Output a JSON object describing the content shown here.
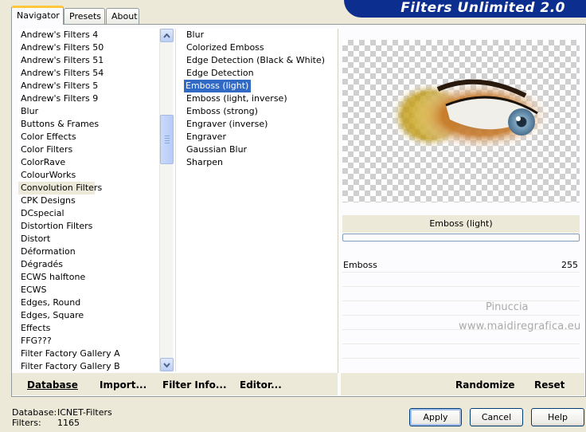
{
  "tabs": [
    "Navigator",
    "Presets",
    "About"
  ],
  "banner": "Filters Unlimited 2.0",
  "categories": [
    "Andrew's Filters 4",
    "Andrew's Filters 50",
    "Andrew's Filters 51",
    "Andrew's Filters 54",
    "Andrew's Filters 5",
    "Andrew's Filters 9",
    "Blur",
    "Buttons & Frames",
    "Color Effects",
    "Color Filters",
    "ColorRave",
    "ColourWorks",
    "Convolution Filters",
    "CPK Designs",
    "DCspecial",
    "Distortion Filters",
    "Distort",
    "Déformation",
    "Dégradés",
    "ECWS halftone",
    "ECWS",
    "Edges, Round",
    "Edges, Square",
    "Effects",
    "FFG???",
    "Filter Factory Gallery A",
    "Filter Factory Gallery B"
  ],
  "filters": [
    "Blur",
    "Colorized Emboss",
    "Edge Detection (Black & White)",
    "Edge Detection",
    "Emboss (light)",
    "Emboss (light, inverse)",
    "Emboss (strong)",
    "Engraver (inverse)",
    "Engraver",
    "Gaussian Blur",
    "Sharpen"
  ],
  "filter_name": "Emboss (light)",
  "param": {
    "name": "Emboss",
    "value": "255"
  },
  "watermark": {
    "line1": "Pinuccia",
    "line2": "www.maidiregrafica.eu"
  },
  "links": {
    "database": "Database",
    "import": "Import...",
    "filter_info": "Filter Info...",
    "editor": "Editor...",
    "randomize": "Randomize",
    "reset": "Reset"
  },
  "status": {
    "db_label": "Database:",
    "db_value": "ICNET-Filters",
    "filters_label": "Filters:",
    "filters_value": "1165"
  },
  "buttons": {
    "apply": "Apply",
    "cancel": "Cancel",
    "help": "Help"
  }
}
